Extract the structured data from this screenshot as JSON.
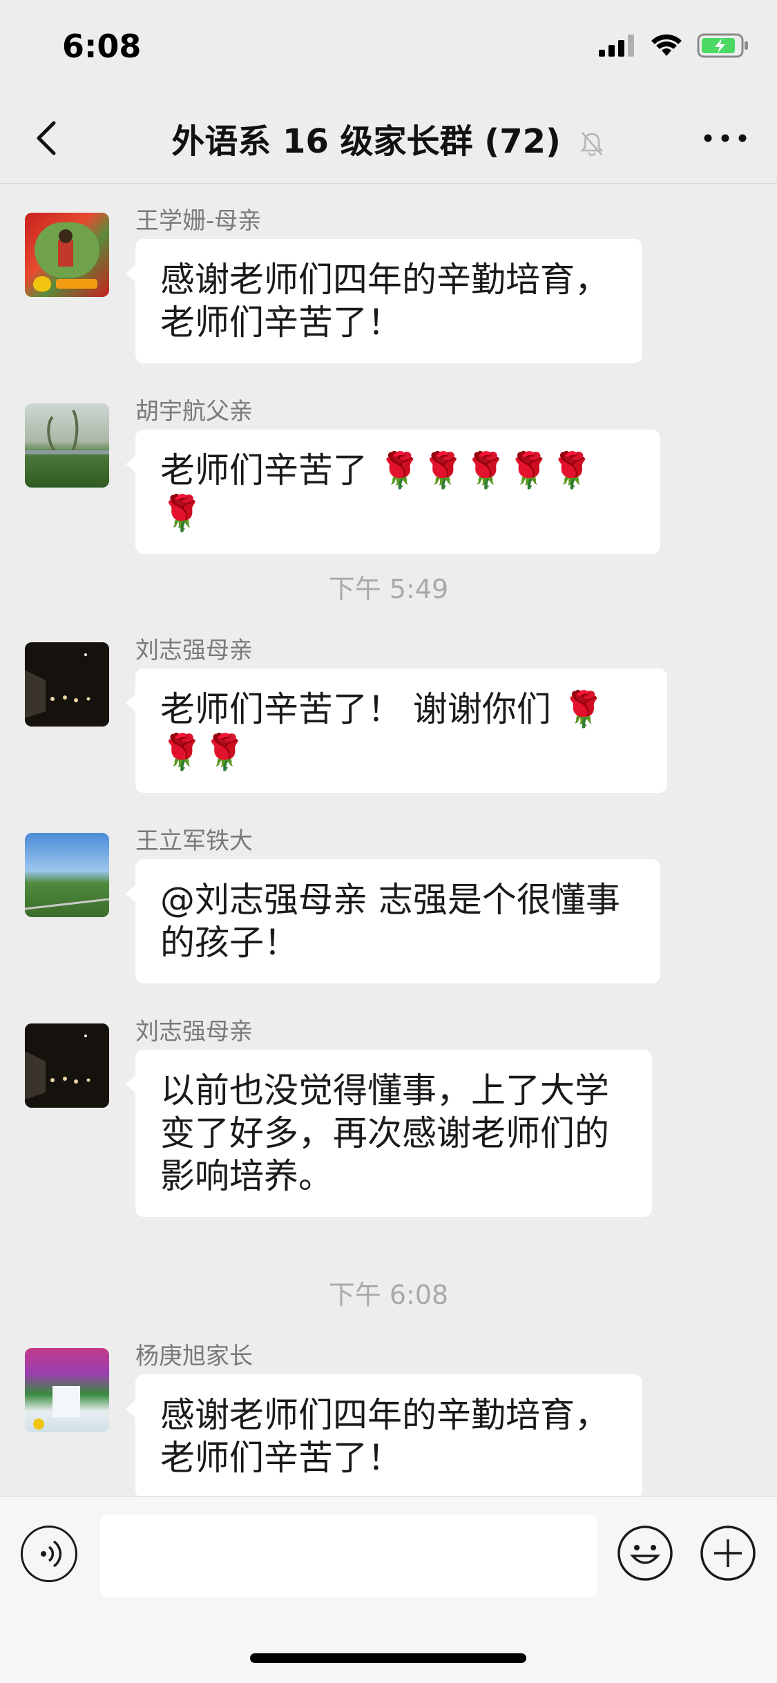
{
  "status_bar": {
    "time": "6:08"
  },
  "nav": {
    "title": "外语系 16 级家长群 (72)"
  },
  "messages": [
    {
      "sender": "王学姗-母亲",
      "text": "感谢老师们四年的辛勤培育，老师们辛苦了！",
      "roses": ""
    },
    {
      "sender": "胡宇航父亲",
      "text": "老师们辛苦了",
      "roses": "🌹🌹🌹🌹🌹🌹"
    },
    {
      "sender": "刘志强母亲",
      "text": "老师们辛苦了！ 谢谢你们",
      "roses": "🌹🌹🌹"
    },
    {
      "sender": "王立军铁大",
      "text": "@刘志强母亲 志强是个很懂事的孩子！",
      "roses": ""
    },
    {
      "sender": "刘志强母亲",
      "text": "以前也没觉得懂事，上了大学变了好多，再次感谢老师们的影响培养。",
      "roses": ""
    },
    {
      "sender": "杨庚旭家长",
      "text": "感谢老师们四年的辛勤培育，老师们辛苦了！",
      "roses": ""
    }
  ],
  "time_separators": [
    "下午 5:49",
    "下午 6:08"
  ],
  "colors": {
    "bg": "#ededed",
    "bubble": "#ffffff",
    "sender": "#7a7a7a",
    "battery": "#4cd964"
  }
}
